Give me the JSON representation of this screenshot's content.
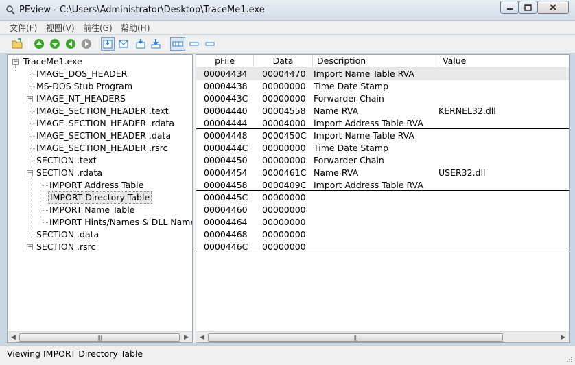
{
  "window": {
    "title": "PEview - C:\\Users\\Administrator\\Desktop\\TraceMe1.exe"
  },
  "menu": [
    "文件(F)",
    "视图(V)",
    "前往(G)",
    "帮助(H)"
  ],
  "toolbar": {
    "icons": [
      "open-folder",
      "nav-first",
      "nav-next",
      "nav-prev",
      "nav-last",
      "view-save",
      "view-envelope",
      "view-down",
      "view-download",
      "view-details",
      "view-list",
      "view-small"
    ]
  },
  "tree": {
    "root": "TraceMe1.exe",
    "items": [
      "IMAGE_DOS_HEADER",
      "MS-DOS Stub Program",
      "IMAGE_NT_HEADERS",
      "IMAGE_SECTION_HEADER .text",
      "IMAGE_SECTION_HEADER .rdata",
      "IMAGE_SECTION_HEADER .data",
      "IMAGE_SECTION_HEADER .rsrc",
      "SECTION .text",
      "SECTION .rdata",
      "IMPORT Address Table",
      "IMPORT Directory Table",
      "IMPORT Name Table",
      "IMPORT Hints/Names & DLL Name",
      "SECTION .data",
      "SECTION .rsrc"
    ],
    "selected": "IMPORT Directory Table"
  },
  "table": {
    "columns": [
      "pFile",
      "Data",
      "Description",
      "Value"
    ],
    "rows": [
      [
        "00004434",
        "00004470",
        "Import Name Table RVA",
        ""
      ],
      [
        "00004438",
        "00000000",
        "Time Date Stamp",
        ""
      ],
      [
        "0000443C",
        "00000000",
        "Forwarder Chain",
        ""
      ],
      [
        "00004440",
        "00004558",
        "Name RVA",
        "KERNEL32.dll"
      ],
      [
        "00004444",
        "00004000",
        "Import Address Table RVA",
        ""
      ],
      [
        "00004448",
        "0000450C",
        "Import Name Table RVA",
        ""
      ],
      [
        "0000444C",
        "00000000",
        "Time Date Stamp",
        ""
      ],
      [
        "00004450",
        "00000000",
        "Forwarder Chain",
        ""
      ],
      [
        "00004454",
        "0000461C",
        "Name RVA",
        "USER32.dll"
      ],
      [
        "00004458",
        "0000409C",
        "Import Address Table RVA",
        ""
      ],
      [
        "0000445C",
        "00000000",
        "",
        ""
      ],
      [
        "00004460",
        "00000000",
        "",
        ""
      ],
      [
        "00004464",
        "00000000",
        "",
        ""
      ],
      [
        "00004468",
        "00000000",
        "",
        ""
      ],
      [
        "0000446C",
        "00000000",
        "",
        ""
      ]
    ]
  },
  "status": {
    "text": "Viewing IMPORT Directory Table"
  },
  "colors": {
    "titlebar": "#dde5ef",
    "panel_border": "#9aa7b5",
    "selection": "#e8e8e8",
    "toolbar_green": "#3aa52a",
    "toolbar_blue": "#2a7fd4"
  }
}
